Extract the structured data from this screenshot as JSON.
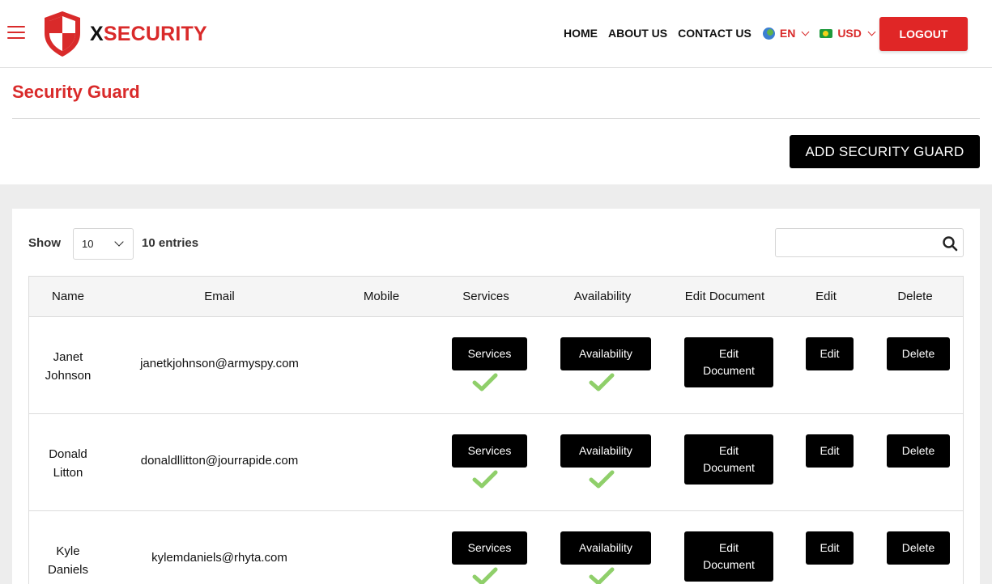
{
  "header": {
    "logo_x": "X",
    "logo_rest": "SECURITY",
    "nav": [
      "HOME",
      "ABOUT US",
      "CONTACT US"
    ],
    "language": "EN",
    "currency": "USD",
    "logout_label": "LOGOUT"
  },
  "page": {
    "title": "Security Guard",
    "add_button_label": "ADD SECURITY GUARD"
  },
  "table_controls": {
    "show_label": "Show",
    "page_size": "10",
    "entries_label": "10 entries",
    "search_value": ""
  },
  "table": {
    "columns": [
      "Name",
      "Email",
      "Mobile",
      "Services",
      "Availability",
      "Edit Document",
      "Edit",
      "Delete"
    ],
    "rows": [
      {
        "first": "Janet",
        "last": "Johnson",
        "email": "janetkjohnson@armyspy.com",
        "mobile": "",
        "services_label": "Services",
        "availability_label": "Availability",
        "edit_doc_line1": "Edit",
        "edit_doc_line2": "Document",
        "edit_label": "Edit",
        "delete_label": "Delete",
        "services_checked": true,
        "availability_checked": true
      },
      {
        "first": "Donald",
        "last": "Litton",
        "email": "donaldllitton@jourrapide.com",
        "mobile": "",
        "services_label": "Services",
        "availability_label": "Availability",
        "edit_doc_line1": "Edit",
        "edit_doc_line2": "Document",
        "edit_label": "Edit",
        "delete_label": "Delete",
        "services_checked": true,
        "availability_checked": true
      },
      {
        "first": "Kyle",
        "last": "Daniels",
        "email": "kylemdaniels@rhyta.com",
        "mobile": "",
        "services_label": "Services",
        "availability_label": "Availability",
        "edit_doc_line1": "Edit",
        "edit_doc_line2": "Document",
        "edit_label": "Edit",
        "delete_label": "Delete",
        "services_checked": true,
        "availability_checked": true
      }
    ]
  },
  "icons": {
    "menu": "hamburger-icon",
    "logo": "shield-icon",
    "language": "globe-icon",
    "currency": "flag-icon",
    "search": "search-icon",
    "check": "check-icon"
  },
  "colors": {
    "brand_red": "#d92a2a",
    "button_black": "#000000",
    "check_green": "#8fcf6a",
    "grey_background": "#ededed"
  }
}
